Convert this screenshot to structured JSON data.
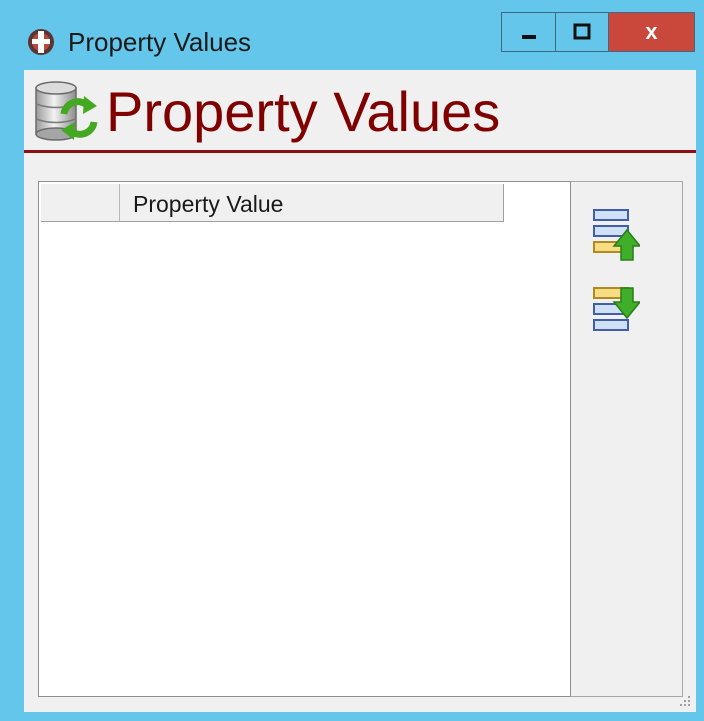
{
  "window": {
    "title": "Property Values",
    "controls": {
      "minimize": "minimize",
      "maximize": "maximize",
      "close": "x"
    }
  },
  "header": {
    "title": "Property Values"
  },
  "grid": {
    "columns": [
      "",
      "Property Value"
    ],
    "rows": []
  },
  "toolbar": {
    "buttons": [
      {
        "name": "move-up",
        "icon": "move-up-icon"
      },
      {
        "name": "move-down",
        "icon": "move-down-icon"
      }
    ]
  },
  "colors": {
    "frame": "#64c6ea",
    "close": "#c9483b",
    "header_title": "#800000",
    "header_rule": "#8b1010"
  }
}
